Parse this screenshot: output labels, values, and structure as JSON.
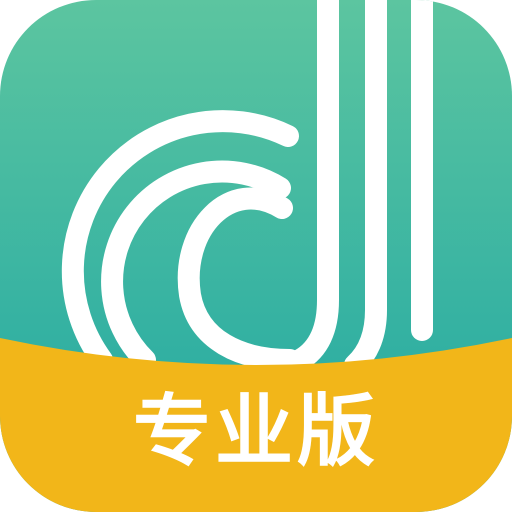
{
  "app_icon": {
    "logo_icon": "stylized-d-music-note-icon",
    "banner_label": "专业版",
    "colors": {
      "gradient_top": "#5cc5a0",
      "gradient_bottom": "#1fa7a3",
      "banner": "#f2b619",
      "logo_stroke": "#ffffff",
      "banner_text": "#ffffff"
    }
  }
}
